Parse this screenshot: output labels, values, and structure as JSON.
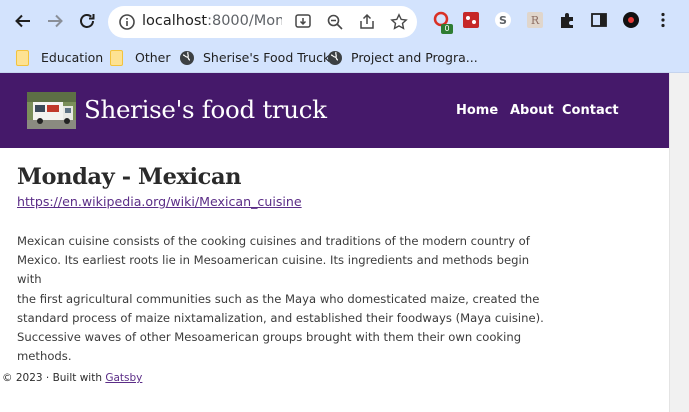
{
  "browser": {
    "url_host": "localhost",
    "url_path": ":8000/Mon...",
    "bookmarks": [
      {
        "label": "Education",
        "type": "folder"
      },
      {
        "label": "Other",
        "type": "folder"
      },
      {
        "label": "Sherise's Food Truck",
        "type": "site"
      },
      {
        "label": "Project and Progra...",
        "type": "site"
      }
    ],
    "extension_badge": "0"
  },
  "site": {
    "title": "Sherise's food truck",
    "nav": [
      "Home",
      "About",
      "Contact"
    ],
    "header_color": "#45196a"
  },
  "article": {
    "heading": "Monday - Mexican",
    "link": "https://en.wikipedia.org/wiki/Mexican_cuisine",
    "lines": [
      "Mexican cuisine consists of the cooking cuisines and traditions of the modern country of",
      "Mexico. Its earliest roots lie in Mesoamerican cuisine. Its ingredients and methods begin with",
      "the first agricultural communities such as the Maya who domesticated maize, created the",
      "standard process of maize nixtamalization, and established their foodways (Maya cuisine).",
      "Successive waves of other Mesoamerican groups brought with them their own cooking",
      "methods."
    ]
  },
  "footer": {
    "prefix": "© 2023 · Built with",
    "link": "Gatsby"
  }
}
